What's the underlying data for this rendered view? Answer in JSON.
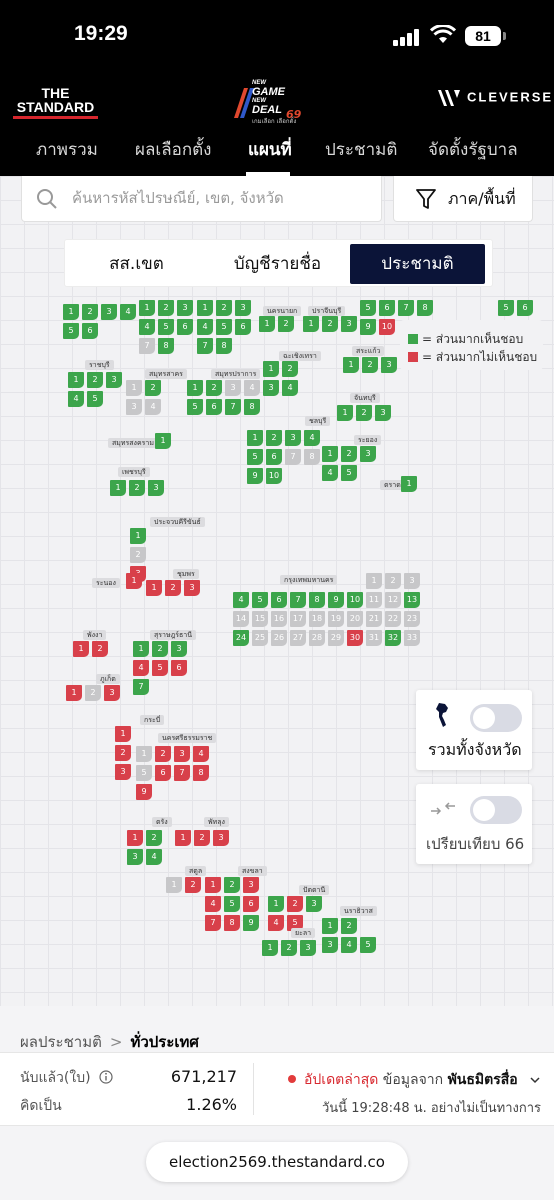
{
  "status": {
    "time": "19:29",
    "battery": "81"
  },
  "brand": {
    "name_line1": "THE",
    "name_line2": "STANDARD",
    "game_line1": "NEW",
    "game_line2": "GAME",
    "game_line3": "NEW",
    "game_line4": "DEAL",
    "game_number": "69",
    "game_sub": "เกมเลือก เลือกตั้ง",
    "partner": "CLEVERSE"
  },
  "nav": {
    "tabs": [
      "ภาพรวม",
      "ผลเลือกตั้ง",
      "แผนที่",
      "ประชามติ",
      "จัดตั้งรัฐบาล"
    ],
    "active": "แผนที่"
  },
  "search": {
    "placeholder": "ค้นหารหัสไปรษณีย์, เขต, จังหวัด",
    "region_label": "ภาค/พื้นที่"
  },
  "segments": {
    "options": [
      "สส.เขต",
      "บัญชีรายชื่อ",
      "ประชามติ"
    ],
    "active": "ประชามติ"
  },
  "legend": {
    "agree": "= ส่วนมากเห็นชอบ",
    "disagree": "= ส่วนมากไม่เห็นชอบ",
    "agree_color": "#3ca54b",
    "disagree_color": "#d8404a",
    "pending_color": "#c7c7c9"
  },
  "toggles": {
    "whole_province": "รวมทั้งจังหวัด",
    "compare": "เปรียบเทียบ 66"
  },
  "map": {
    "provinces": [
      {
        "name": "นครนายก"
      },
      {
        "name": "ปราจีนบุรี"
      },
      {
        "name": "ฉะเชิงเทรา"
      },
      {
        "name": "สระแก้ว"
      },
      {
        "name": "ราชบุรี"
      },
      {
        "name": "สมุทรสาคร"
      },
      {
        "name": "สมุทรปราการ"
      },
      {
        "name": "ชลบุรี"
      },
      {
        "name": "จันทบุรี"
      },
      {
        "name": "ระยอง"
      },
      {
        "name": "สมุทรสงคราม"
      },
      {
        "name": "เพชรบุรี"
      },
      {
        "name": "ตราด"
      },
      {
        "name": "ประจวบคีรีขันธ์"
      },
      {
        "name": "ชุมพร"
      },
      {
        "name": "ระนอง"
      },
      {
        "name": "กรุงเทพมหานคร"
      },
      {
        "name": "พังงา"
      },
      {
        "name": "สุราษฎร์ธานี"
      },
      {
        "name": "ภูเก็ต"
      },
      {
        "name": "กระบี่"
      },
      {
        "name": "นครศรีธรรมราช"
      },
      {
        "name": "ตรัง"
      },
      {
        "name": "พัทลุง"
      },
      {
        "name": "สตูล"
      },
      {
        "name": "สงขลา"
      },
      {
        "name": "ปัตตานี"
      },
      {
        "name": "ยะลา"
      },
      {
        "name": "นราธิวาส"
      }
    ]
  },
  "bottom": {
    "crumb_parent": "ผลประชามติ",
    "crumb_current": "ทั่วประเทศ",
    "counted_label": "นับแล้ว(ใบ)",
    "counted_value": "671,217",
    "percent_label": "คิดเป็น",
    "percent_value": "1.26%",
    "update_label": "อัปเดตล่าสุด",
    "source_prefix": "ข้อมูลจาก",
    "source_name": "พันธมิตรสื่อ",
    "update_time": "วันนี้ 19:28:48 น. อย่างไม่เป็นทางการ",
    "url": "election2569.thestandard.co"
  }
}
